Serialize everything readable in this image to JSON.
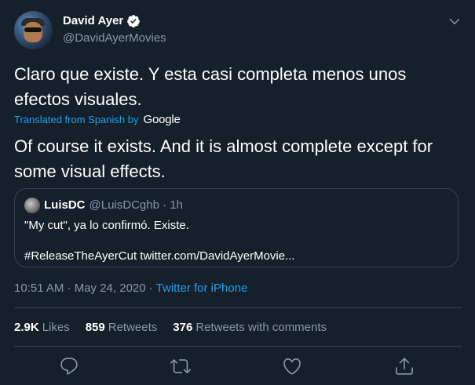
{
  "author": {
    "display_name": "David Ayer",
    "handle": "@DavidAyerMovies"
  },
  "tweet": {
    "original_text": "Claro que existe. Y esta casi completa menos unos efectos visuales.",
    "translated_label": "Translated from Spanish by",
    "translator": "Google",
    "translated_text": "Of course it exists. And it is almost complete except for some visual effects."
  },
  "quoted": {
    "display_name": "LuisDC",
    "handle_time": "@LuisDCghb · 1h",
    "line1": "\"My cut\", ya lo confirmó. Existe.",
    "line2": "#ReleaseTheAyerCut twitter.com/DavidAyerMovie..."
  },
  "meta": {
    "timestamp": "10:51 AM · May 24, 2020 · ",
    "source": "Twitter for iPhone"
  },
  "stats": {
    "likes_count": "2.9K",
    "likes_label": "Likes",
    "retweets_count": "859",
    "retweets_label": "Retweets",
    "quotes_count": "376",
    "quotes_label": "Retweets with comments"
  },
  "colors": {
    "background": "#15202b",
    "accent": "#1da1f2",
    "muted": "#8899a6",
    "border": "#38444d"
  },
  "icons": {
    "verified": "verified-badge-icon",
    "menu": "chevron-down-icon",
    "reply": "reply-icon",
    "retweet": "retweet-icon",
    "like": "heart-icon",
    "share": "share-icon"
  }
}
